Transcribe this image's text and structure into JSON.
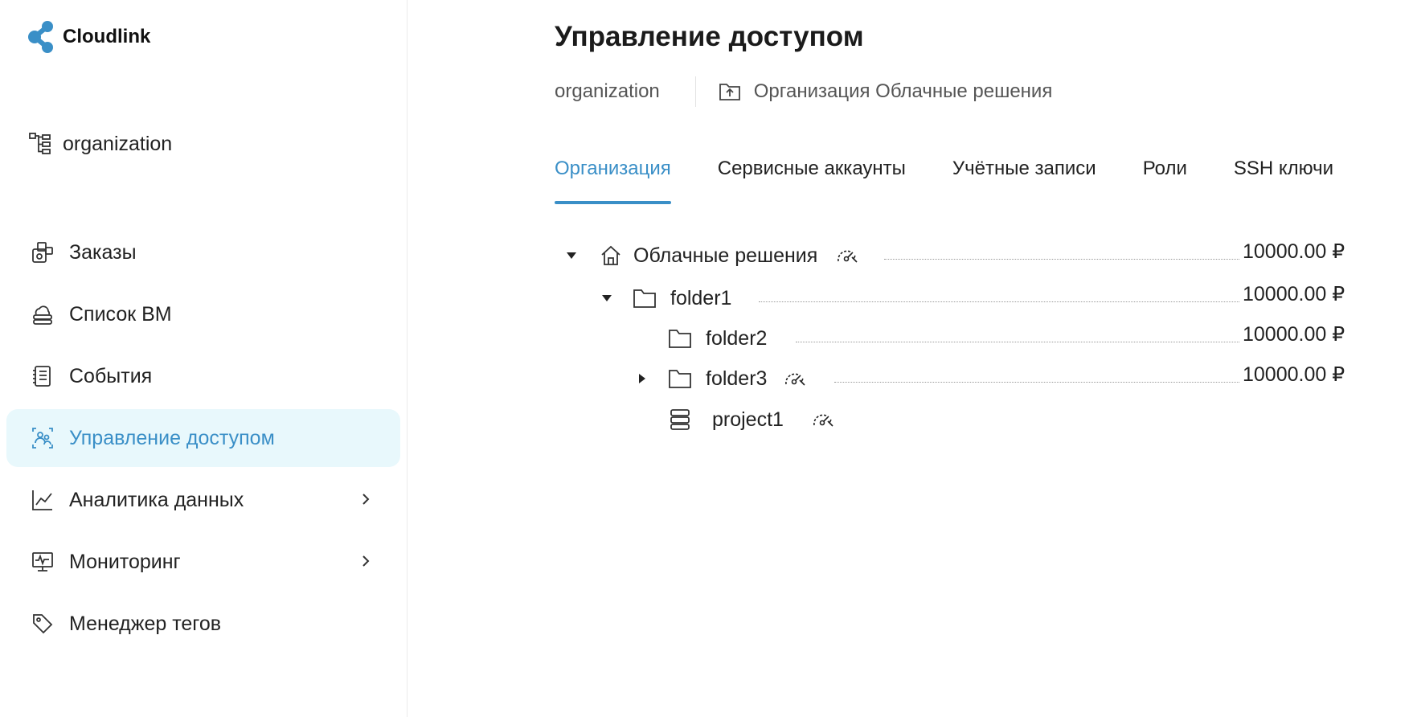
{
  "app": {
    "name": "Cloudlink"
  },
  "sidebar": {
    "org_label": "organization",
    "items": [
      {
        "label": "Заказы"
      },
      {
        "label": "Список ВМ"
      },
      {
        "label": "События"
      },
      {
        "label": "Управление доступом"
      },
      {
        "label": "Аналитика данных"
      },
      {
        "label": "Мониторинг"
      },
      {
        "label": "Менеджер тегов"
      }
    ]
  },
  "header": {
    "title": "Управление доступом",
    "breadcrumb": {
      "current": "organization",
      "link": "Организация Облачные решения"
    }
  },
  "tabs": [
    {
      "label": "Организация"
    },
    {
      "label": "Сервисные аккаунты"
    },
    {
      "label": "Учётные записи"
    },
    {
      "label": "Роли"
    },
    {
      "label": "SSH ключи"
    }
  ],
  "tree": [
    {
      "name": "Облачные решения",
      "amount": "10000.00 ₽",
      "icon": "home-icon",
      "toggle": "expanded",
      "quota_icon": true
    },
    {
      "name": "folder1",
      "amount": "10000.00 ₽",
      "icon": "folder-icon",
      "toggle": "expanded",
      "quota_icon": false
    },
    {
      "name": "folder2",
      "amount": "10000.00 ₽",
      "icon": "folder-icon",
      "toggle": "none",
      "quota_icon": false
    },
    {
      "name": "folder3",
      "amount": "10000.00 ₽",
      "icon": "folder-icon",
      "toggle": "collapsed",
      "quota_icon": true
    },
    {
      "name": "project1",
      "amount": "",
      "icon": "project-stack-icon",
      "toggle": "none",
      "quota_icon": true
    }
  ],
  "colors": {
    "accent": "#3a8fc7",
    "active_bg": "#e8f8fc"
  }
}
